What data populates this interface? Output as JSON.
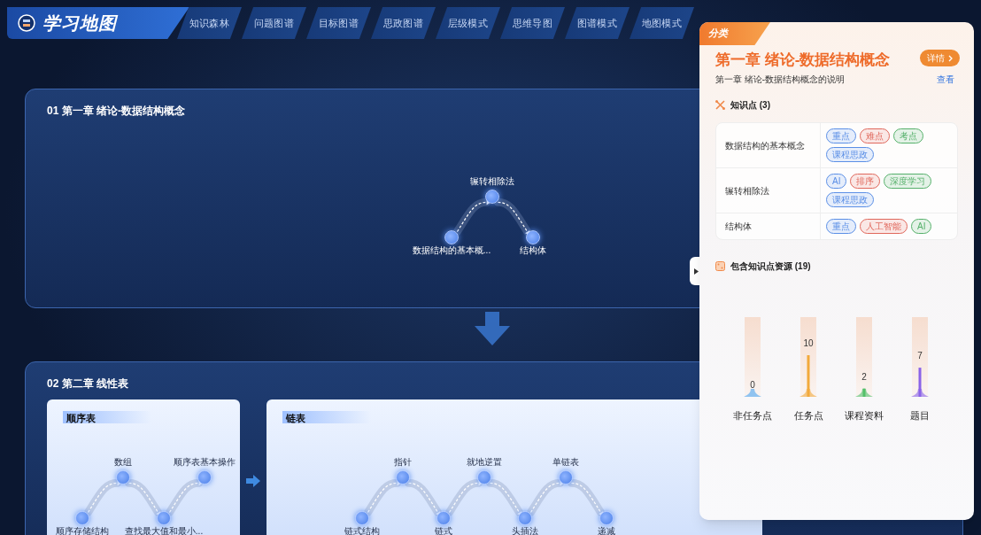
{
  "app": {
    "title": "学习地图"
  },
  "nav_tabs": [
    {
      "label": "知识森林",
      "selected": false
    },
    {
      "label": "问题图谱",
      "selected": false
    },
    {
      "label": "目标图谱",
      "selected": false
    },
    {
      "label": "思政图谱",
      "selected": false
    },
    {
      "label": "层级模式",
      "selected": false
    },
    {
      "label": "思维导图",
      "selected": false
    },
    {
      "label": "图谱模式",
      "selected": false
    },
    {
      "label": "地图模式",
      "selected": false
    }
  ],
  "sections": [
    {
      "title": "01 第一章 绪论-数据结构概念",
      "groups": [
        {
          "nodes": [
            "数据结构的基本概...",
            "辗转相除法",
            "结构体"
          ]
        }
      ]
    },
    {
      "title": "02 第二章 线性表",
      "groups": [
        {
          "title": "顺序表",
          "nodes": [
            "顺序存储结构",
            "数组",
            "查找最大值和最小...",
            "顺序表基本操作"
          ]
        },
        {
          "title": "链表",
          "nodes": [
            "链式结构",
            "指针",
            "链式",
            "就地逆置",
            "头插法",
            "单链表",
            "递减"
          ]
        }
      ]
    }
  ],
  "panel": {
    "badge": "分类",
    "title": "第一章 绪论-数据结构概念",
    "detail_button": "详情",
    "description": "第一章 绪论-数据结构概念的说明",
    "view_link": "查看",
    "knowledge_heading": "知识点 (3)",
    "knowledge_points": [
      {
        "name": "数据结构的基本概念",
        "tags": [
          {
            "label": "重点",
            "color": "#5b8fe6"
          },
          {
            "label": "难点",
            "color": "#e0685c"
          },
          {
            "label": "考点",
            "color": "#55b06a"
          },
          {
            "label": "课程思政",
            "color": "#5b8fe6"
          }
        ]
      },
      {
        "name": "辗转相除法",
        "tags": [
          {
            "label": "AI",
            "color": "#5b8fe6"
          },
          {
            "label": "排序",
            "color": "#e0685c"
          },
          {
            "label": "深度学习",
            "color": "#55b06a"
          },
          {
            "label": "课程思政",
            "color": "#5b8fe6"
          }
        ]
      },
      {
        "name": "结构体",
        "tags": [
          {
            "label": "重点",
            "color": "#5b8fe6"
          },
          {
            "label": "人工智能",
            "color": "#e0685c"
          },
          {
            "label": "AI",
            "color": "#55b06a"
          }
        ]
      }
    ],
    "resources_heading": "包含知识点资源 (19)",
    "chart_data": {
      "type": "bar",
      "categories": [
        "非任务点",
        "任务点",
        "课程资料",
        "题目"
      ],
      "series": [
        {
          "values": [
            0,
            10,
            2,
            7
          ]
        }
      ],
      "data_labels": true
    }
  }
}
